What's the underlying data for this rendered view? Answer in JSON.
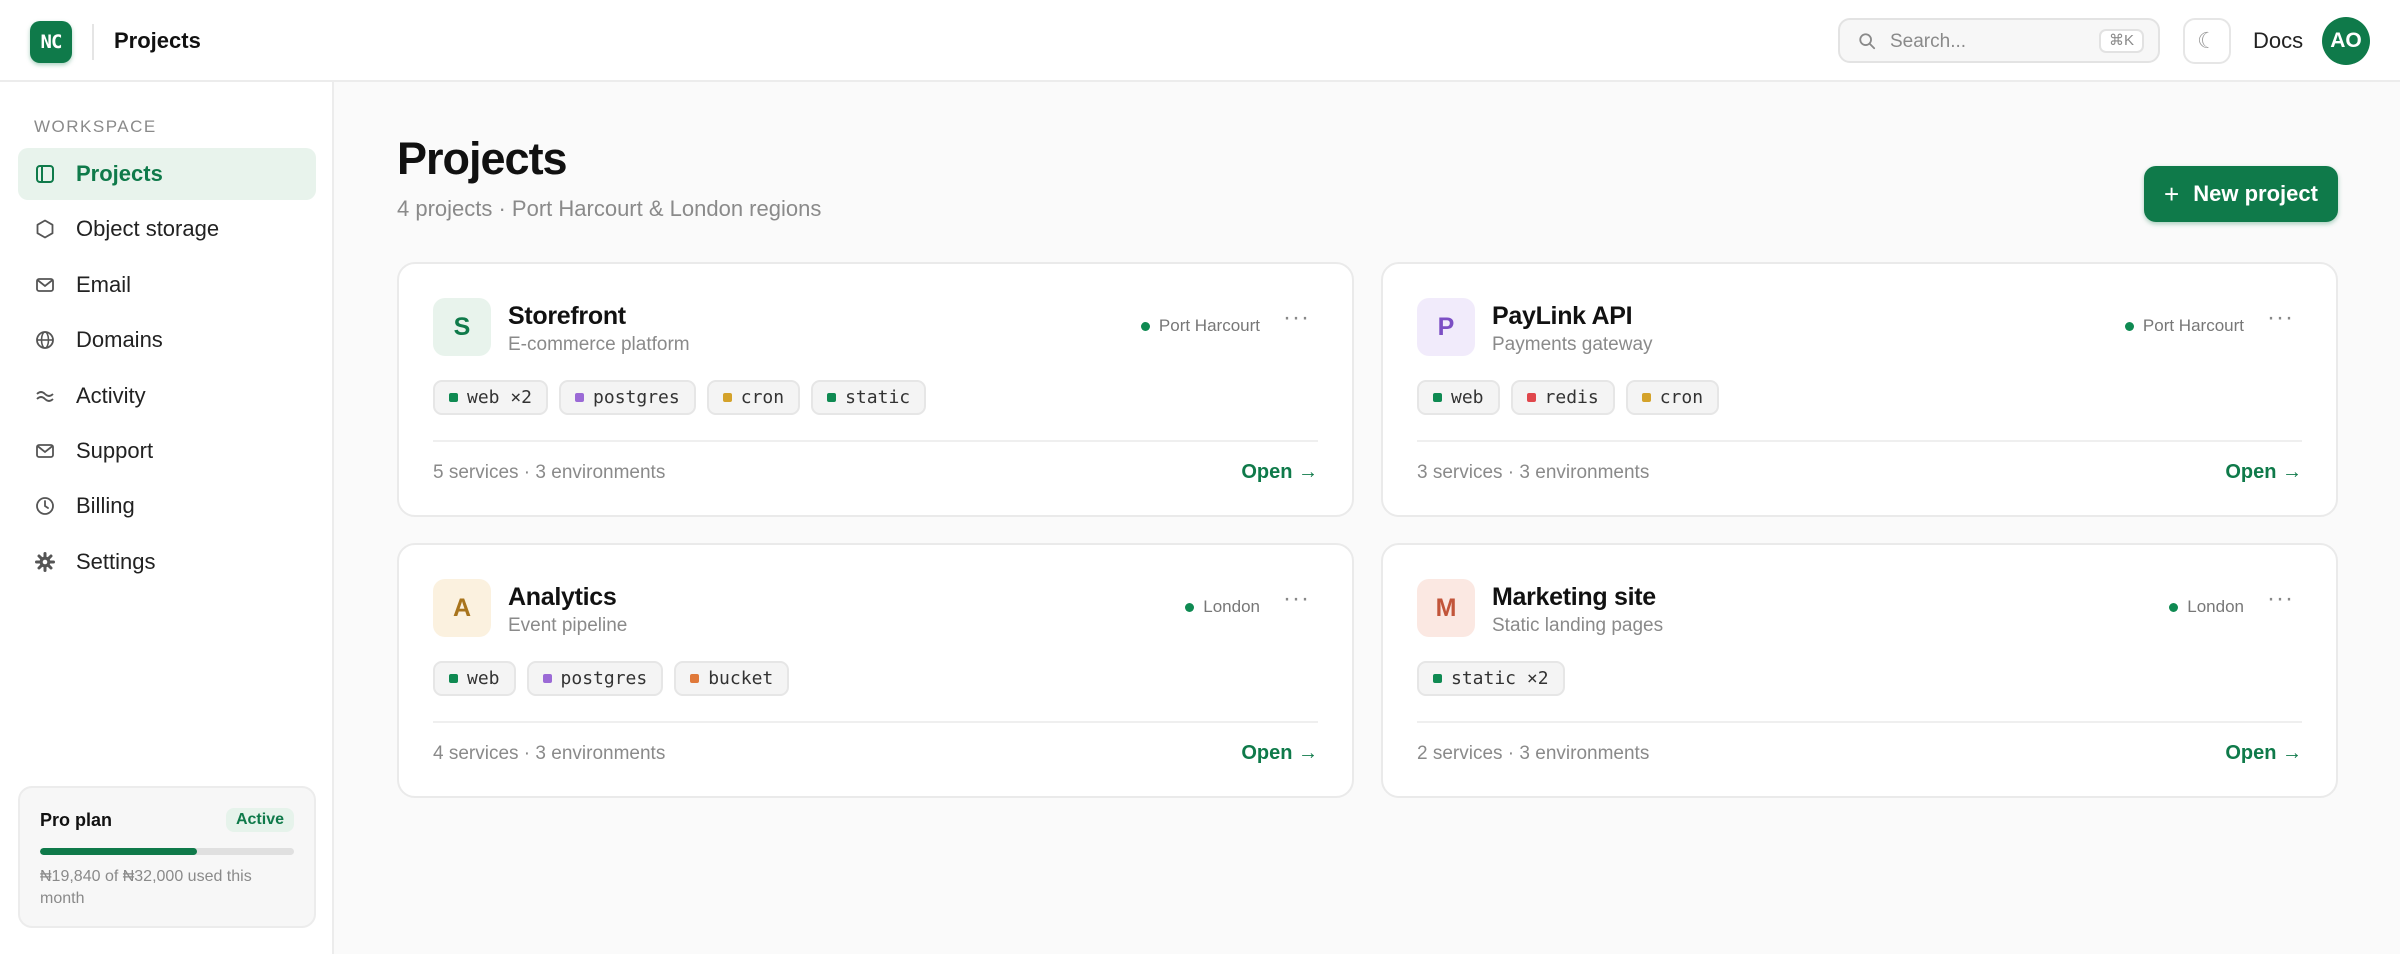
{
  "header": {
    "logo_text": "NC",
    "title": "Projects",
    "search_placeholder": "Search...",
    "search_shortcut": "⌘K",
    "theme_icon": "moon-icon",
    "docs_label": "Docs",
    "avatar_initials": "AO"
  },
  "sidebar": {
    "section_label": "WORKSPACE",
    "items": [
      {
        "label": "Projects",
        "icon": "projects-icon",
        "active": true
      },
      {
        "label": "Object storage",
        "icon": "hexagon-icon",
        "active": false
      },
      {
        "label": "Email",
        "icon": "mail-icon",
        "active": false
      },
      {
        "label": "Domains",
        "icon": "globe-icon",
        "active": false
      },
      {
        "label": "Activity",
        "icon": "activity-icon",
        "active": false
      },
      {
        "label": "Support",
        "icon": "mail-icon",
        "active": false
      },
      {
        "label": "Billing",
        "icon": "clock-icon",
        "active": false
      },
      {
        "label": "Settings",
        "icon": "gear-icon",
        "active": false
      }
    ],
    "plan": {
      "name": "Pro plan",
      "badge": "Active",
      "usage_fraction": 0.62,
      "usage_text": "₦19,840 of ₦32,000 used this month"
    }
  },
  "main": {
    "title": "Projects",
    "subtitle": "4 projects · Port Harcourt & London regions",
    "new_button": "New project",
    "projects": [
      {
        "initial": "S",
        "name": "Storefront",
        "description": "E-commerce platform",
        "region": "Port Harcourt",
        "tags": [
          {
            "label": "web ×2",
            "color": "#0f8a52"
          },
          {
            "label": "postgres",
            "color": "#9b6ad6"
          },
          {
            "label": "cron",
            "color": "#d4a22a"
          },
          {
            "label": "static",
            "color": "#0f8a52"
          }
        ],
        "meta": "5 services · 3 environments",
        "open_label": "Open →",
        "avatar_bg": "#e8f3ec",
        "avatar_fg": "#0f7a4a"
      },
      {
        "initial": "P",
        "name": "PayLink API",
        "description": "Payments gateway",
        "region": "Port Harcourt",
        "tags": [
          {
            "label": "web",
            "color": "#0f8a52"
          },
          {
            "label": "redis",
            "color": "#e0474c"
          },
          {
            "label": "cron",
            "color": "#d4a22a"
          }
        ],
        "meta": "3 services · 3 environments",
        "open_label": "Open →",
        "avatar_bg": "#f1ebfb",
        "avatar_fg": "#7c4fc4"
      },
      {
        "initial": "A",
        "name": "Analytics",
        "description": "Event pipeline",
        "region": "London",
        "tags": [
          {
            "label": "web",
            "color": "#0f8a52"
          },
          {
            "label": "postgres",
            "color": "#9b6ad6"
          },
          {
            "label": "bucket",
            "color": "#e0793a"
          }
        ],
        "meta": "4 services · 3 environments",
        "open_label": "Open →",
        "avatar_bg": "#fbf1df",
        "avatar_fg": "#a8741c"
      },
      {
        "initial": "M",
        "name": "Marketing site",
        "description": "Static landing pages",
        "region": "London",
        "tags": [
          {
            "label": "static ×2",
            "color": "#0f8a52"
          }
        ],
        "meta": "2 services · 3 environments",
        "open_label": "Open →",
        "avatar_bg": "#fbe8e2",
        "avatar_fg": "#c2553a"
      }
    ]
  }
}
